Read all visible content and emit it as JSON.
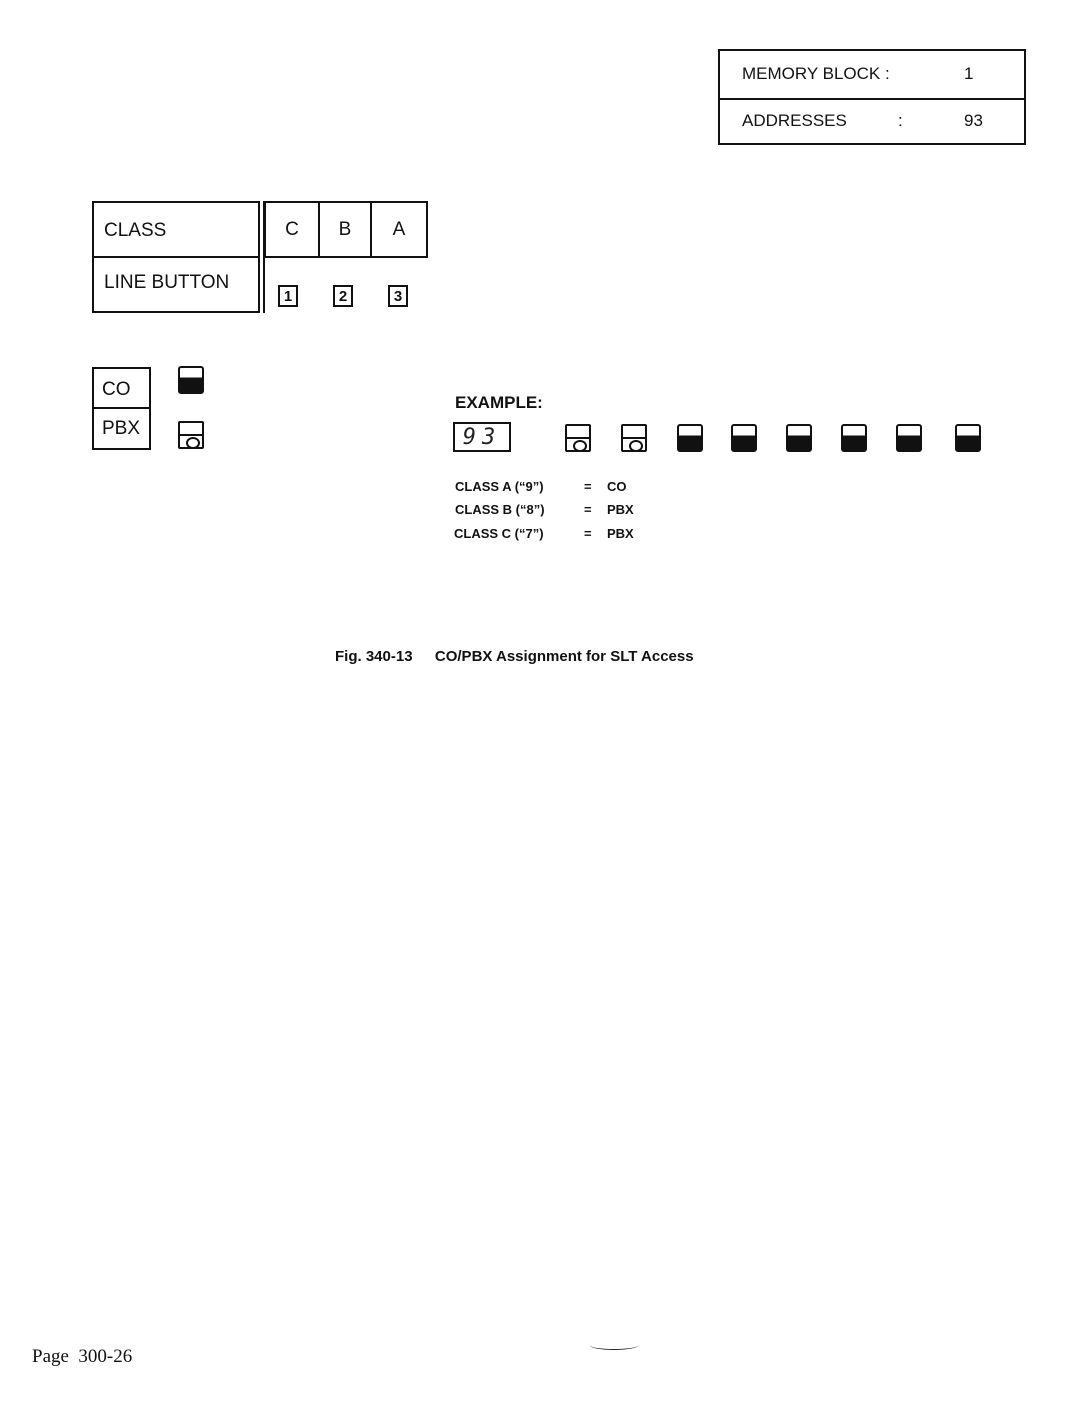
{
  "memory_table": {
    "rows": [
      {
        "label": "MEMORY BLOCK :",
        "colon": "",
        "value": "1"
      },
      {
        "label": "ADDRESSES",
        "colon": ":",
        "value": "93"
      }
    ]
  },
  "class_table": {
    "row_labels": [
      "CLASS",
      "LINE BUTTON"
    ],
    "classes": [
      "C",
      "B",
      "A"
    ],
    "buttons": [
      "1",
      "2",
      "3"
    ]
  },
  "legend": {
    "items": [
      {
        "label": "CO",
        "icon": "lamp-lit-icon"
      },
      {
        "label": "PBX",
        "icon": "lamp-unlit-icon"
      }
    ]
  },
  "example": {
    "heading": "EXAMPLE:",
    "display": "93",
    "lamps": [
      "unlit",
      "unlit",
      "lit",
      "lit",
      "lit",
      "lit",
      "lit",
      "lit"
    ],
    "assignments": [
      {
        "class": "CLASS A (“9”)",
        "eq": "=",
        "value": "CO"
      },
      {
        "class": "CLASS B  (“8”)",
        "eq": "=",
        "value": "PBX"
      },
      {
        "class": "CLASS C (“7”)",
        "eq": "=",
        "value": "PBX"
      }
    ]
  },
  "caption": {
    "fig": "Fig. 340-13",
    "title": "CO/PBX Assignment for SLT Access"
  },
  "footer": {
    "page": "Page  300-26"
  }
}
